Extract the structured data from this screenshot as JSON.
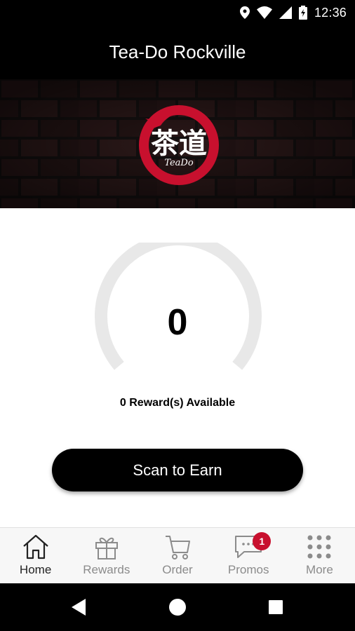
{
  "status": {
    "time": "12:36"
  },
  "appbar": {
    "title": "Tea-Do Rockville"
  },
  "banner": {
    "logo_chars": "茶道",
    "logo_script": "TeaDo"
  },
  "rewards": {
    "points": "0",
    "available_text": "0 Reward(s) Available",
    "progress": 0
  },
  "cta": {
    "label": "Scan to Earn"
  },
  "tabs": [
    {
      "label": "Home",
      "icon": "home-icon",
      "active": true
    },
    {
      "label": "Rewards",
      "icon": "gift-icon"
    },
    {
      "label": "Order",
      "icon": "cart-icon"
    },
    {
      "label": "Promos",
      "icon": "chat-icon",
      "badge": "1"
    },
    {
      "label": "More",
      "icon": "grid-icon"
    }
  ],
  "colors": {
    "brand_red": "#c8102e",
    "bar": "#000000",
    "gauge_track": "#e8e8e8"
  }
}
